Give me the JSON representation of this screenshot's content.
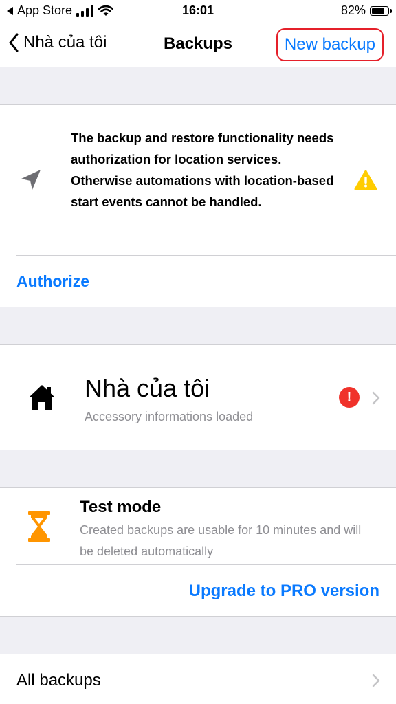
{
  "status_bar": {
    "carrier": "App Store",
    "time": "16:01",
    "battery": "82%",
    "battery_level": 0.82
  },
  "nav": {
    "back_label": "Nhà của tôi",
    "title": "Backups",
    "action_label": "New backup"
  },
  "location": {
    "message": "The backup and restore functionality needs authorization for location services. Otherwise automations with location-based start events cannot be handled.",
    "icon": "location-arrow-icon",
    "warning_icon": "warning-triangle-icon",
    "authorize_label": "Authorize"
  },
  "home": {
    "name": "Nhà của tôi",
    "status": "Accessory informations loaded",
    "icon": "house-icon",
    "badge": "!"
  },
  "test_mode": {
    "title": "Test mode",
    "description": "Created backups are usable for 10 minutes and will be deleted automatically",
    "icon": "hourglass-icon",
    "upgrade_label": "Upgrade to PRO version"
  },
  "all_backups": {
    "label": "All backups"
  },
  "colors": {
    "accent": "#0a7aff",
    "warning": "#ffcc00",
    "alert": "#f0322b",
    "hourglass": "#ff9500",
    "highlight_border": "#e5202a"
  }
}
